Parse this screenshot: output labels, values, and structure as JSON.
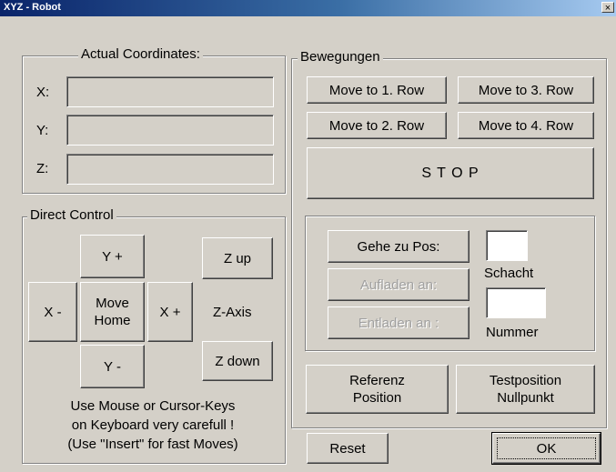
{
  "window": {
    "title": "XYZ - Robot",
    "close_label": "×"
  },
  "coords": {
    "legend": "Actual Coordinates:",
    "x_label": "X:",
    "y_label": "Y:",
    "z_label": "Z:",
    "x_value": "",
    "y_value": "",
    "z_value": ""
  },
  "direct": {
    "legend": "Direct Control",
    "y_plus": "Y +",
    "y_minus": "Y -",
    "x_minus": "X -",
    "x_plus": "X +",
    "move_home": "Move\nHome",
    "z_up": "Z up",
    "z_axis": "Z-Axis",
    "z_down": "Z down",
    "hint": "Use Mouse or Cursor-Keys\non Keyboard very carefull !\n(Use \"Insert\" for fast Moves)"
  },
  "moves": {
    "legend": "Bewegungen",
    "row1": "Move to 1. Row",
    "row2": "Move to 2. Row",
    "row3": "Move to 3. Row",
    "row4": "Move to 4. Row",
    "stop": "S T O P"
  },
  "pos": {
    "goto": "Gehe zu Pos:",
    "load": "Aufladen an:",
    "unload": "Entladen an :",
    "schacht_label": "Schacht",
    "nummer_label": "Nummer",
    "schacht_value": "",
    "nummer_value": ""
  },
  "bottom": {
    "referenz": "Referenz\nPosition",
    "testposition": "Testposition\nNullpunkt",
    "reset": "Reset",
    "ok": "OK"
  }
}
